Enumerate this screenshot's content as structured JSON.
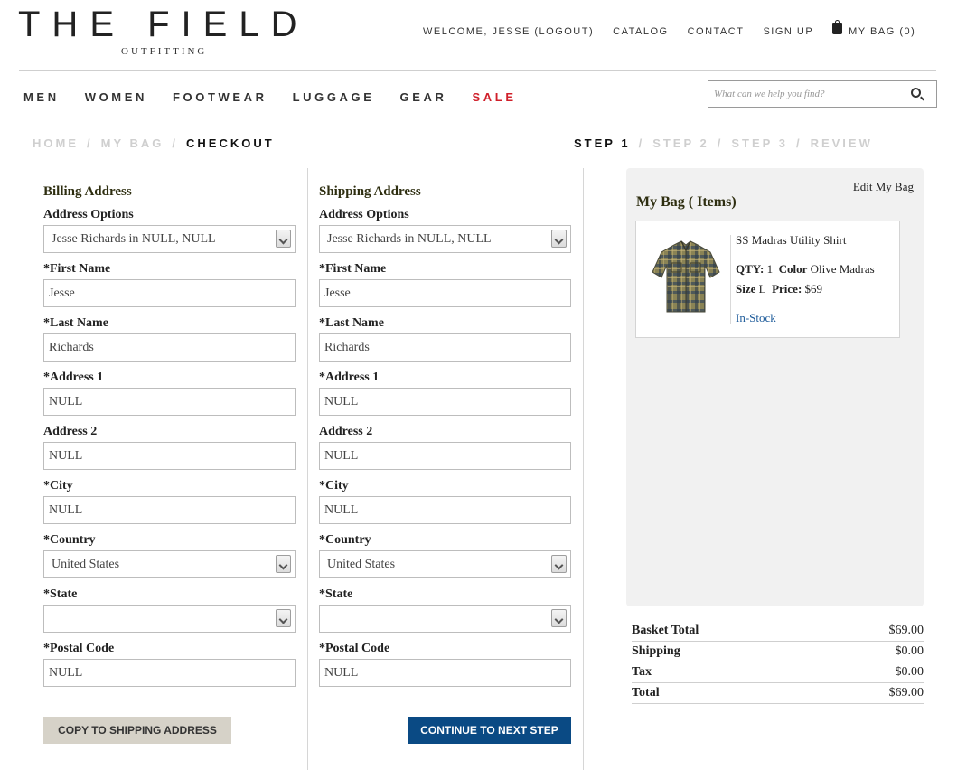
{
  "header": {
    "logo_main": "THE FIELD",
    "logo_sub": "—OUTFITTING—",
    "welcome": "WELCOME, JESSE (LOGOUT)",
    "catalog": "CATALOG",
    "contact": "CONTACT",
    "sign_up": "SIGN UP",
    "my_bag": "MY BAG (0)"
  },
  "nav": {
    "items": [
      "MEN",
      "WOMEN",
      "FOOTWEAR",
      "LUGGAGE",
      "GEAR",
      "SALE"
    ],
    "sale_color": "#d01f2a"
  },
  "search": {
    "placeholder": "What can we help you find?"
  },
  "breadcrumb": {
    "home": "HOME",
    "bag": "MY BAG",
    "current": "CHECKOUT",
    "sep": "/"
  },
  "steps": {
    "step1": "STEP 1",
    "step2": "STEP 2",
    "step3": "STEP 3",
    "review": "REVIEW"
  },
  "billing": {
    "title": "Billing Address",
    "options_label": "Address Options",
    "options_value": "Jesse Richards in NULL, NULL",
    "first_label": "*First Name",
    "first_value": "Jesse",
    "last_label": "*Last Name",
    "last_value": "Richards",
    "addr1_label": "*Address 1",
    "addr1_value": "NULL",
    "addr2_label": "Address 2",
    "addr2_value": "NULL",
    "city_label": "*City",
    "city_value": "NULL",
    "country_label": "*Country",
    "country_value": "United States",
    "state_label": "*State",
    "state_value": "",
    "postal_label": "*Postal Code",
    "postal_value": "NULL"
  },
  "shipping": {
    "title": "Shipping Address",
    "options_label": "Address Options",
    "options_value": "Jesse Richards in NULL, NULL",
    "first_label": "*First Name",
    "first_value": "Jesse",
    "last_label": "*Last Name",
    "last_value": "Richards",
    "addr1_label": "*Address 1",
    "addr1_value": "NULL",
    "addr2_label": "Address 2",
    "addr2_value": "NULL",
    "city_label": "*City",
    "city_value": "NULL",
    "country_label": "*Country",
    "country_value": "United States",
    "state_label": "*State",
    "state_value": "",
    "postal_label": "*Postal Code",
    "postal_value": "NULL"
  },
  "buttons": {
    "copy": "COPY TO SHIPPING ADDRESS",
    "next": "CONTINUE TO NEXT STEP",
    "next_color": "#0a4a84"
  },
  "bag": {
    "edit": "Edit My Bag",
    "title": "My Bag ( Items)",
    "item": {
      "name": "SS Madras Utility Shirt",
      "qty_label": "QTY:",
      "qty": "1",
      "color_label": "Color",
      "color": "Olive Madras",
      "size_label": "Size",
      "size": "L",
      "price_label": "Price:",
      "price": "$69",
      "stock": "In-Stock"
    }
  },
  "totals": {
    "basket_label": "Basket Total",
    "basket": "$69.00",
    "shipping_label": "Shipping",
    "shipping": "$0.00",
    "tax_label": "Tax",
    "tax": "$0.00",
    "total_label": "Total",
    "total": "$69.00"
  }
}
